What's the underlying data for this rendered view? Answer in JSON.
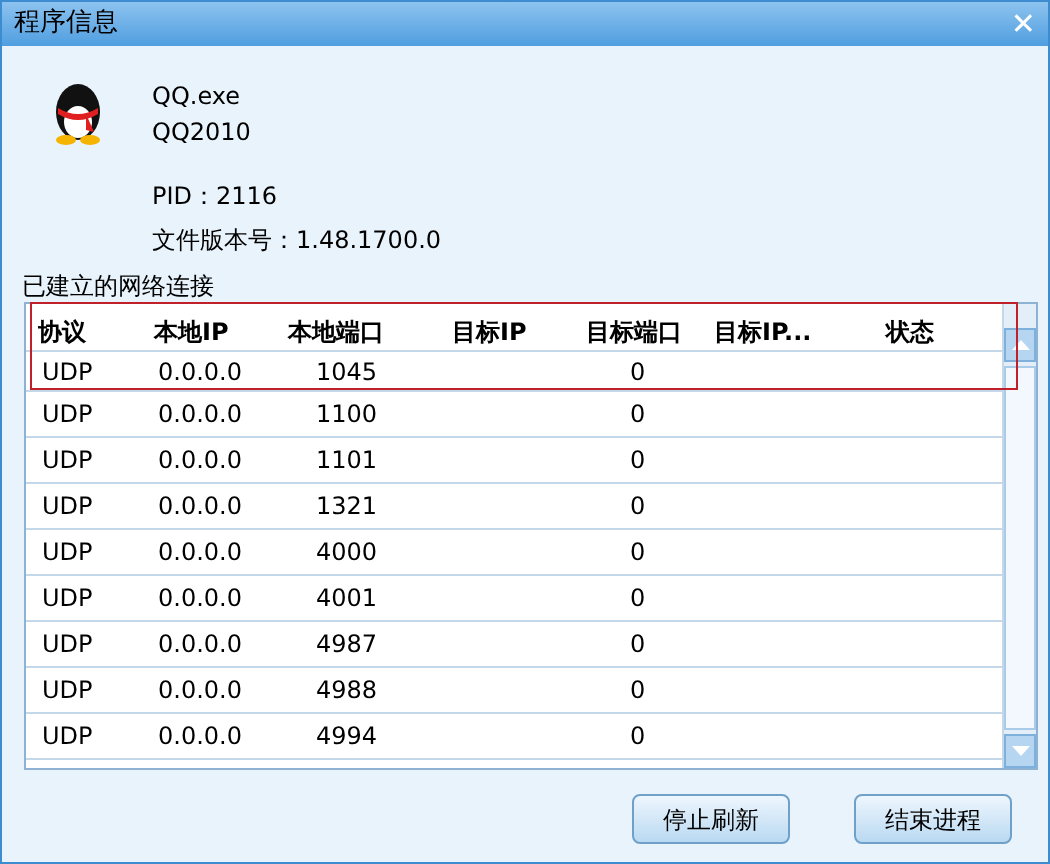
{
  "window": {
    "title": "程序信息",
    "close": "✕"
  },
  "program": {
    "name": "QQ.exe",
    "product": "QQ2010",
    "pid": "PID：2116",
    "version": "文件版本号：1.48.1700.0"
  },
  "section_label": "已建立的网络连接",
  "table": {
    "columns": [
      "协议",
      "本地IP",
      "本地端口",
      "目标IP",
      "目标端口",
      "目标IP...",
      "状态"
    ],
    "rows": [
      [
        "UDP",
        "0.0.0.0",
        "1045",
        "",
        "0",
        "",
        ""
      ],
      [
        "UDP",
        "0.0.0.0",
        "1100",
        "",
        "0",
        "",
        ""
      ],
      [
        "UDP",
        "0.0.0.0",
        "1101",
        "",
        "0",
        "",
        ""
      ],
      [
        "UDP",
        "0.0.0.0",
        "1321",
        "",
        "0",
        "",
        ""
      ],
      [
        "UDP",
        "0.0.0.0",
        "4000",
        "",
        "0",
        "",
        ""
      ],
      [
        "UDP",
        "0.0.0.0",
        "4001",
        "",
        "0",
        "",
        ""
      ],
      [
        "UDP",
        "0.0.0.0",
        "4987",
        "",
        "0",
        "",
        ""
      ],
      [
        "UDP",
        "0.0.0.0",
        "4988",
        "",
        "0",
        "",
        ""
      ],
      [
        "UDP",
        "0.0.0.0",
        "4994",
        "",
        "0",
        "",
        ""
      ]
    ]
  },
  "buttons": [
    "停止刷新",
    "结束进程"
  ]
}
